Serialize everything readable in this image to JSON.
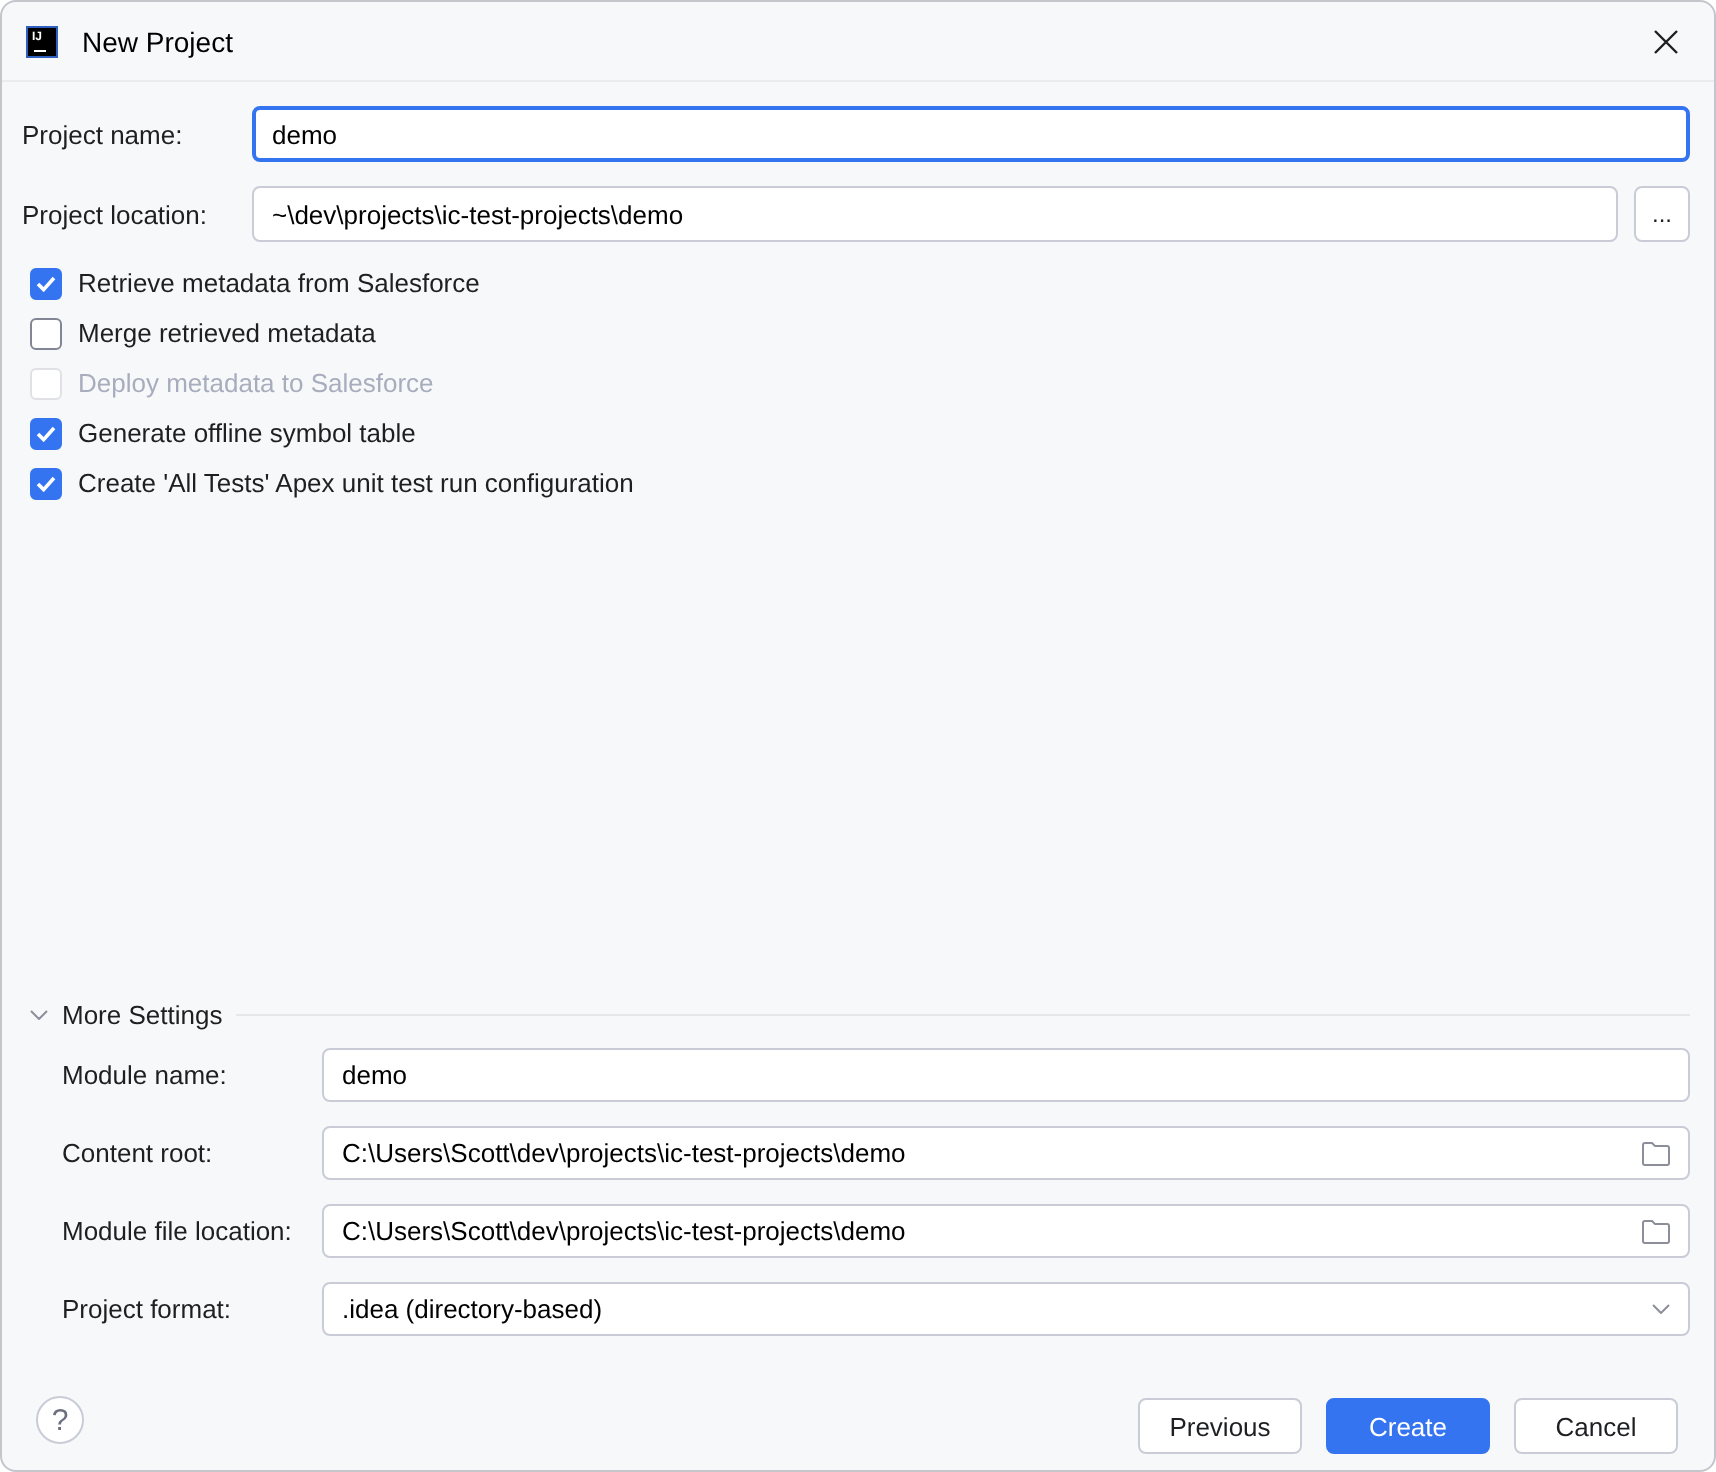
{
  "window": {
    "title": "New Project",
    "logo_text": "IJ"
  },
  "fields": [
    {
      "kind": "text",
      "label": "Project name:",
      "value": "demo",
      "focused": true
    },
    {
      "kind": "browse",
      "label": "Project location:",
      "value": "~\\dev\\projects\\ic-test-projects\\demo",
      "focused": false,
      "button": "..."
    }
  ],
  "options": [
    {
      "label": "Retrieve metadata from Salesforce",
      "checked": true,
      "disabled": false
    },
    {
      "label": "Merge retrieved metadata",
      "checked": false,
      "disabled": false
    },
    {
      "label": "Deploy metadata to Salesforce",
      "checked": false,
      "disabled": true
    },
    {
      "label": "Generate offline symbol table",
      "checked": true,
      "disabled": false
    },
    {
      "label": "Create 'All Tests' Apex unit test run configuration",
      "checked": true,
      "disabled": false
    }
  ],
  "more_settings": {
    "title": "More Settings",
    "expanded": true,
    "fields": [
      {
        "kind": "text",
        "label": "Module name:",
        "value": "demo"
      },
      {
        "kind": "folder",
        "label": "Content root:",
        "value": "C:\\Users\\Scott\\dev\\projects\\ic-test-projects\\demo"
      },
      {
        "kind": "folder",
        "label": "Module file location:",
        "value": "C:\\Users\\Scott\\dev\\projects\\ic-test-projects\\demo"
      },
      {
        "kind": "dropdown",
        "label": "Project format:",
        "value": ".idea (directory-based)"
      }
    ]
  },
  "footer": {
    "help": "?",
    "buttons": [
      {
        "label": "Previous",
        "kind": "secondary"
      },
      {
        "label": "Create",
        "kind": "primary"
      },
      {
        "label": "Cancel",
        "kind": "secondary"
      }
    ]
  }
}
